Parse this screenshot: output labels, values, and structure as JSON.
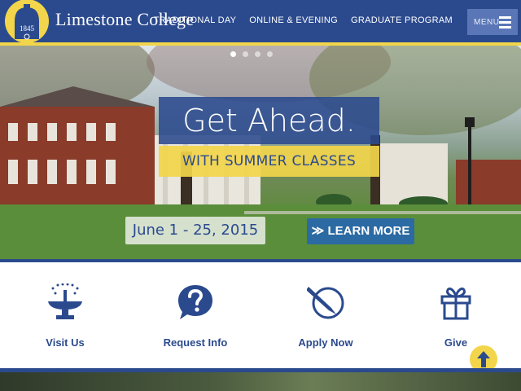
{
  "header": {
    "brand": "Limestone College",
    "seal_year": "1845",
    "nav": [
      {
        "label": "TRADITIONAL DAY"
      },
      {
        "label": "ONLINE & EVENING"
      },
      {
        "label": "GRADUATE PROGRAM"
      }
    ],
    "menu_label": "MENU"
  },
  "hero": {
    "slides": 4,
    "active_slide": 1,
    "headline": "Get Ahead.",
    "subheadline": "WITH SUMMER CLASSES",
    "dates": "June 1 - 25, 2015",
    "cta": "≫ LEARN MORE"
  },
  "quick_links": [
    {
      "label": "Visit Us",
      "icon": "fountain-icon"
    },
    {
      "label": "Request Info",
      "icon": "question-bubble-icon"
    },
    {
      "label": "Apply Now",
      "icon": "pen-icon"
    },
    {
      "label": "Give",
      "icon": "gift-icon"
    }
  ],
  "colors": {
    "navy": "#2b4a8e",
    "gold": "#f2d54a",
    "white": "#ffffff"
  }
}
